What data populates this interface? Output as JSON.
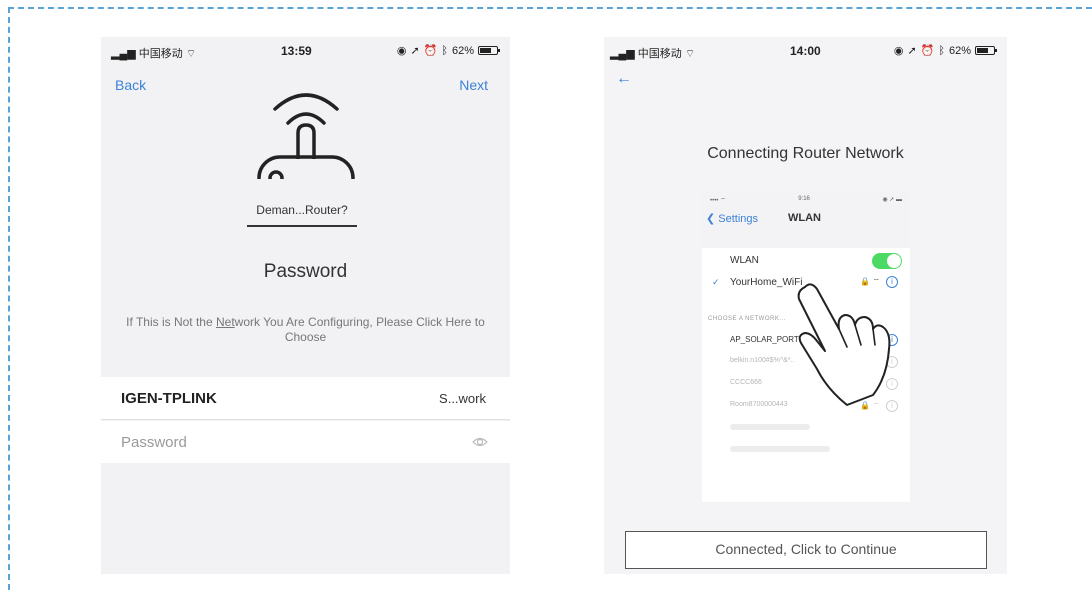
{
  "phone1": {
    "status": {
      "carrier": "中国移动",
      "time": "13:59",
      "battery": "62%"
    },
    "back_label": "Back",
    "next_label": "Next",
    "network_select": "Deman...Router?",
    "password_title": "Password",
    "hint_prefix": "If This is Not the ",
    "hint_link": "Net",
    "hint_suffix": "work You Are Configuring, Please Click Here to Choose",
    "ssid": "IGEN-TPLINK",
    "network_name": "S...work",
    "password_placeholder": "Password"
  },
  "phone2": {
    "status": {
      "carrier": "中国移动",
      "time": "14:00",
      "battery": "62%"
    },
    "back_icon": "left-arrow-icon",
    "title": "Connecting Router Network",
    "screenshot": {
      "status_time": "9:16",
      "back_label": "Settings",
      "title": "WLAN",
      "wlan_label": "WLAN",
      "wlan_on": true,
      "connected_network": "YourHome_WiFi",
      "section_header": "CHOOSE A NETWORK...",
      "networks": [
        "AP_SOLAR_PORT",
        "belkin.n100#$%^&*..",
        "CCCC666",
        "Room8700000443"
      ]
    },
    "continue_label": "Connected, Click to Continue"
  },
  "colors": {
    "accent": "#3b82d6",
    "frame": "#5aa3d6",
    "toggle_on": "#4cd964",
    "background": "#f2f2f5"
  }
}
